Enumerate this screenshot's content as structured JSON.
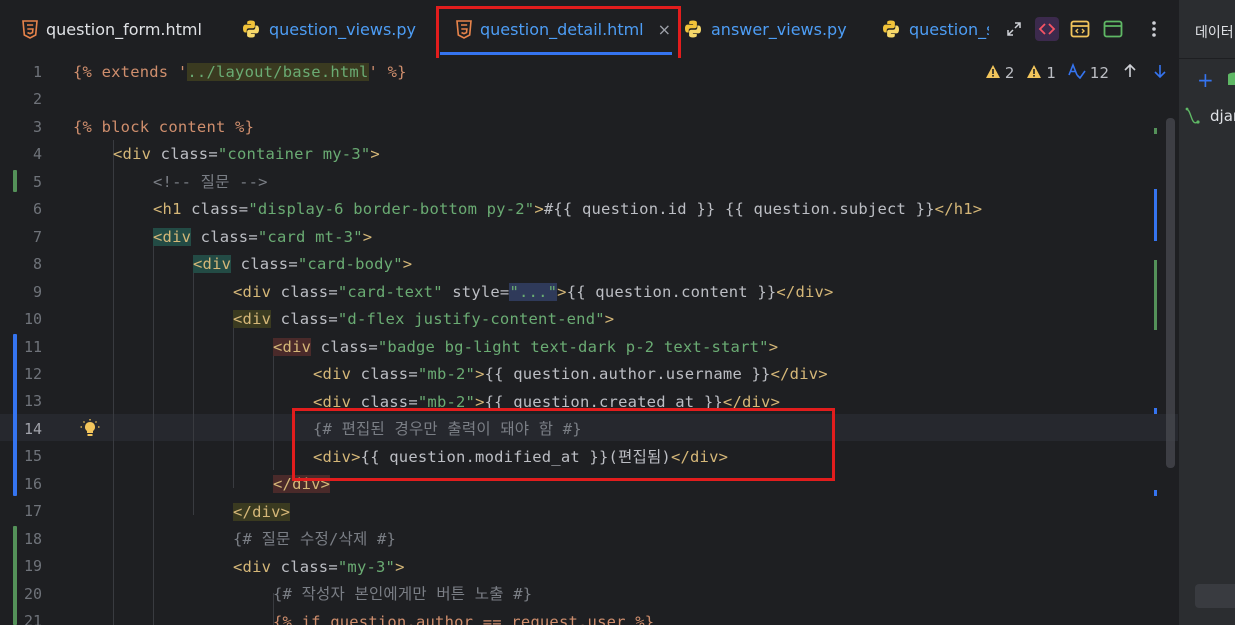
{
  "tabs": [
    {
      "label": "question_form.html",
      "kind": "html"
    },
    {
      "label": "question_views.py",
      "kind": "py"
    },
    {
      "label": "question_detail.html",
      "kind": "html",
      "active": true
    },
    {
      "label": "answer_views.py",
      "kind": "py"
    },
    {
      "label": "question_s",
      "kind": "py"
    }
  ],
  "close_glyph": "×",
  "inspections": {
    "warnings_a": "2",
    "warnings_b": "1",
    "typos": "12"
  },
  "right_panel": {
    "title": "데이터",
    "item": "djan"
  },
  "lines": [
    {
      "n": "1"
    },
    {
      "n": "2"
    },
    {
      "n": "3"
    },
    {
      "n": "4"
    },
    {
      "n": "5"
    },
    {
      "n": "6"
    },
    {
      "n": "7"
    },
    {
      "n": "8"
    },
    {
      "n": "9"
    },
    {
      "n": "10"
    },
    {
      "n": "11"
    },
    {
      "n": "12"
    },
    {
      "n": "13"
    },
    {
      "n": "14"
    },
    {
      "n": "15"
    },
    {
      "n": "16"
    },
    {
      "n": "17"
    },
    {
      "n": "18"
    },
    {
      "n": "19"
    },
    {
      "n": "20"
    },
    {
      "n": "21"
    }
  ],
  "code": {
    "l1a": "{% extends '",
    "l1b": "../layout/base.html",
    "l1c": "' %}",
    "l3": "{% block content %}",
    "l4a": "<div",
    "l4b": " class=",
    "l4c": "\"container my-3\"",
    "l4d": ">",
    "l5": "<!-- 질문 -->",
    "l6a": "<h1",
    "l6b": " class=",
    "l6c": "\"display-6 border-bottom py-2\"",
    "l6d": ">",
    "l6e": "#{{ question.id }} {{ question.subject }}",
    "l6f": "</h1>",
    "l7a": "<div",
    "l7b": " class=",
    "l7c": "\"card mt-3\"",
    "l7d": ">",
    "l8a": "<div",
    "l8b": " class=",
    "l8c": "\"card-body\"",
    "l8d": ">",
    "l9a": "<div",
    "l9b": " class=",
    "l9c": "\"card-text\"",
    "l9d": " style=",
    "l9e": "\"...\"",
    "l9f": ">",
    "l9g": "{{ question.content }}",
    "l9h": "</div>",
    "l10a": "<div",
    "l10b": " class=",
    "l10c": "\"d-flex justify-content-end\"",
    "l10d": ">",
    "l11a": "<div",
    "l11b": " class=",
    "l11c": "\"badge bg-light text-dark p-2 text-start\"",
    "l11d": ">",
    "l12a": "<div",
    "l12b": " class=",
    "l12c": "\"mb-2\"",
    "l12d": ">",
    "l12e": "{{ question.author.username }}",
    "l12f": "</div>",
    "l13a": "<div",
    "l13b": " class=",
    "l13c": "\"mb-2\"",
    "l13d": ">",
    "l13e": "{{ question.created_at }}",
    "l13f": "</div>",
    "l14": "{# 편집된 경우만 출력이 돼야 함 #}",
    "l15a": "<div>",
    "l15b": "{{ question.modified_at }}(편집됨)",
    "l15c": "</div>",
    "l16": "</div>",
    "l17": "</div>",
    "l18": "{# 질문 수정/삭제 #}",
    "l19a": "<div",
    "l19b": " class=",
    "l19c": "\"my-3\"",
    "l19d": ">",
    "l20": "{# 작성자 본인에게만 버튼 노출 #}",
    "l21": "{% if question.author == request.user %}"
  },
  "colors": {
    "highlight": "#e21d1d",
    "accent": "#3574f0"
  }
}
